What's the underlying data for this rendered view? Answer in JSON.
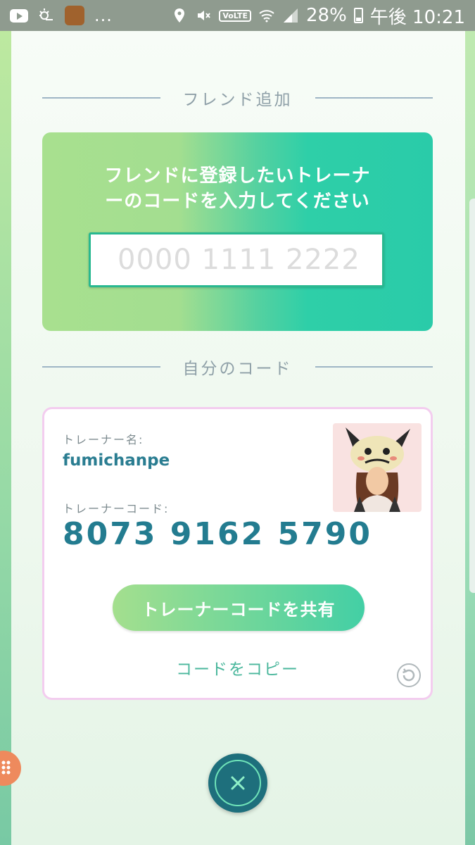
{
  "status_bar": {
    "battery": "28%",
    "time": "午後 10:21",
    "more": "...",
    "volte": "VoLTE"
  },
  "friend_add": {
    "section_title": "フレンド追加",
    "instruction_line1": "フレンドに登録したいトレーナ",
    "instruction_line2": "ーのコードを入力してください",
    "input_placeholder": "0000 1111 2222",
    "input_value": ""
  },
  "my_code": {
    "section_title": "自分のコード",
    "trainer_name_label": "トレーナー名:",
    "trainer_name": "fumichanpe",
    "trainer_code_label": "トレーナーコード:",
    "trainer_code": "8073 9162 5790",
    "share_button": "トレーナーコードを共有",
    "copy_link": "コードをコピー"
  },
  "icons": {
    "close": "close-icon",
    "refresh": "refresh-icon"
  },
  "colors": {
    "accent": "#2acba9",
    "code_text": "#237c90",
    "card_border": "#f3cdef",
    "close_button": "#1e6f7c"
  }
}
